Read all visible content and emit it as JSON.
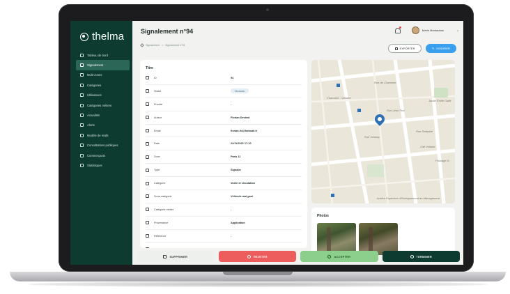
{
  "app": {
    "logo_text": "thelma"
  },
  "sidebar": {
    "items": [
      {
        "label": "Tableau de bord",
        "icon": "dashboard-icon",
        "active": false
      },
      {
        "label": "Signalement",
        "icon": "alert-icon",
        "active": true
      },
      {
        "label": "Multi-zones",
        "icon": "zones-icon",
        "active": false
      },
      {
        "label": "Catégories",
        "icon": "categories-icon",
        "active": false
      },
      {
        "label": "Utilisateurs",
        "icon": "users-icon",
        "active": false
      },
      {
        "label": "Catégories métiers",
        "icon": "briefcase-icon",
        "active": false
      },
      {
        "label": "Actualités",
        "icon": "news-icon",
        "active": false
      },
      {
        "label": "Alerte",
        "icon": "alert-circle-icon",
        "active": false
      },
      {
        "label": "Modèle de mails",
        "icon": "mail-icon",
        "active": false
      },
      {
        "label": "Consultations publiques",
        "icon": "consultation-icon",
        "active": false
      },
      {
        "label": "Commerçants",
        "icon": "shop-icon",
        "active": false
      },
      {
        "label": "Statistiques",
        "icon": "stats-icon",
        "active": false
      }
    ]
  },
  "header": {
    "title": "Signalement n°94",
    "breadcrumb": [
      "Signalement",
      "Signalement n°94"
    ],
    "user_name": "Marie Montauban",
    "export_label": "EXPORTER",
    "modify_label": "MODIFIER"
  },
  "details": {
    "section_title": "Titre",
    "rows": [
      {
        "label": "ID",
        "value": "94",
        "icon": "id-icon"
      },
      {
        "label": "Statut",
        "value": "Nouveau",
        "icon": "star-icon",
        "badge": true
      },
      {
        "label": "Priorité",
        "value": "-",
        "icon": "priority-icon"
      },
      {
        "label": "Auteur",
        "value": "Florian Devtest",
        "icon": "user-icon"
      },
      {
        "label": "Email",
        "value": "florian-94@hotmail.fr",
        "icon": "email-icon"
      },
      {
        "label": "Date",
        "value": "22/11/2022 17:10",
        "icon": "calendar-icon"
      },
      {
        "label": "Zone",
        "value": "Paris 11",
        "icon": "zone-icon"
      },
      {
        "label": "Type",
        "value": "Signaler",
        "icon": "type-icon"
      },
      {
        "label": "Catégorie",
        "value": "Voirie et circulation",
        "icon": "category-icon"
      },
      {
        "label": "Sous-catégorie",
        "value": "Véhicule mal garé",
        "icon": "subcategory-icon"
      },
      {
        "label": "Catégorie métier",
        "value": "-",
        "icon": "briefcase-icon"
      },
      {
        "label": "Provenance",
        "value": "Application",
        "icon": "source-icon"
      },
      {
        "label": "Référence",
        "value": "-",
        "icon": "reference-icon"
      },
      {
        "label": "Adresse",
        "value": "44 Rue Chanzy 75011 Paris France",
        "icon": "location-icon"
      },
      {
        "label": "Commentaire",
        "value": "-",
        "icon": "comment-icon"
      }
    ]
  },
  "map": {
    "labels": [
      "Rue de Charonne",
      "Charonne - Voltaire",
      "Rue Chanzy",
      "Rue Delépine",
      "Cité Voltaire",
      "Rue Léon Frot",
      "Institut Supérieur d'Enseignement au Management",
      "Jardin Émile Gallé",
      "Passage G"
    ]
  },
  "photos": {
    "title": "Photos",
    "count": 2
  },
  "actions": {
    "delete_label": "SUPPRIMER",
    "reject_label": "REJETER",
    "accept_label": "ACCEPTER",
    "finish_label": "TERMINER"
  },
  "colors": {
    "sidebar_bg": "#0d3b30",
    "sidebar_active": "#2b6656",
    "modify_btn": "#3aa0ee",
    "reject_btn": "#ee5d5d",
    "accept_btn": "#8ccf8c",
    "finish_btn": "#0d3b30"
  }
}
